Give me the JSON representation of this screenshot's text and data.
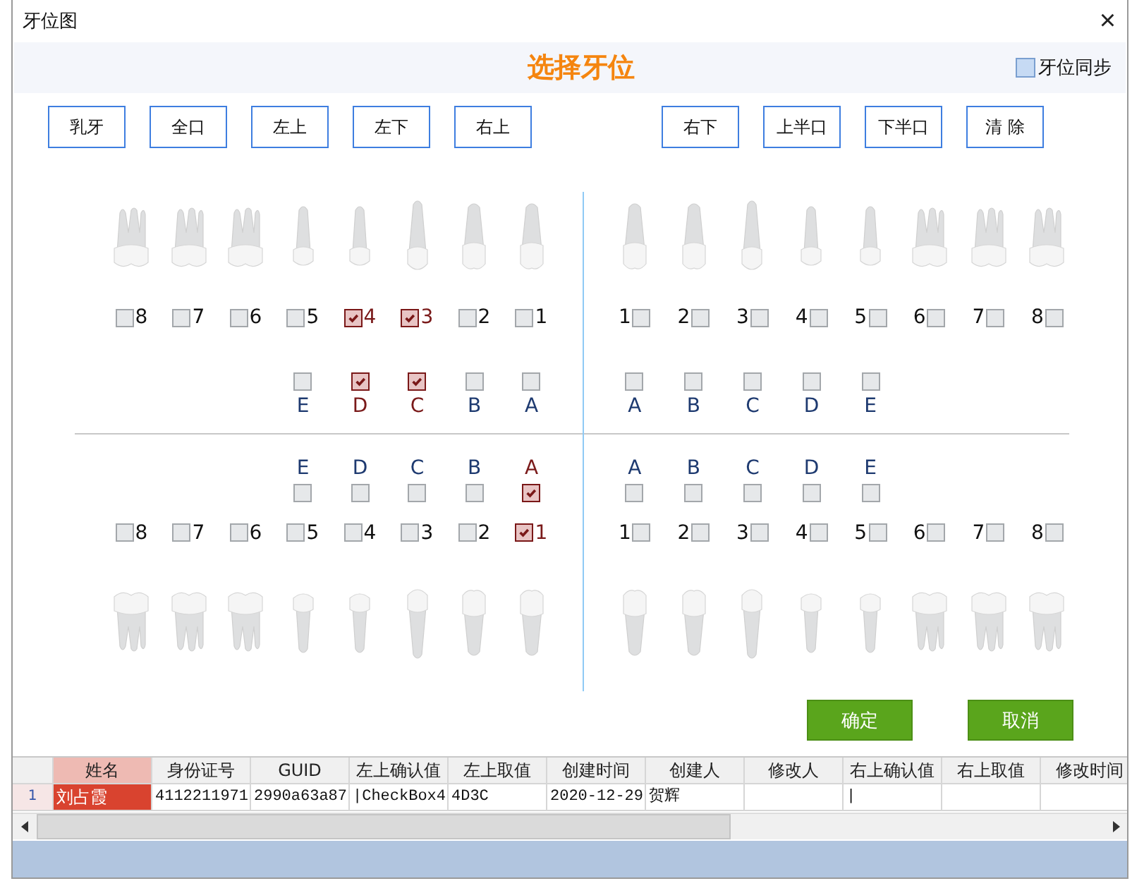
{
  "window": {
    "title": "牙位图",
    "close": "×"
  },
  "header": {
    "title": "选择牙位",
    "sync": {
      "label": "牙位同步",
      "checked": false
    }
  },
  "buttons_left": [
    "乳牙",
    "全口",
    "左上",
    "左下",
    "右上"
  ],
  "buttons_right": [
    "右下",
    "上半口",
    "下半口",
    "清 除"
  ],
  "quadrants": {
    "upper_left": {
      "teeth": [
        {
          "label": "8",
          "kind": "molar",
          "checked": false
        },
        {
          "label": "7",
          "kind": "molar",
          "checked": false
        },
        {
          "label": "6",
          "kind": "molar",
          "checked": false
        },
        {
          "label": "5",
          "kind": "premolar",
          "checked": false
        },
        {
          "label": "4",
          "kind": "premolar",
          "checked": true
        },
        {
          "label": "3",
          "kind": "canine",
          "checked": true
        },
        {
          "label": "2",
          "kind": "incisor",
          "checked": false
        },
        {
          "label": "1",
          "kind": "incisor",
          "checked": false
        }
      ],
      "primary": [
        {
          "label": "E",
          "checked": false
        },
        {
          "label": "D",
          "checked": true
        },
        {
          "label": "C",
          "checked": true
        },
        {
          "label": "B",
          "checked": false
        },
        {
          "label": "A",
          "checked": false
        }
      ]
    },
    "upper_right": {
      "teeth": [
        {
          "label": "1",
          "kind": "incisor",
          "checked": false
        },
        {
          "label": "2",
          "kind": "incisor",
          "checked": false
        },
        {
          "label": "3",
          "kind": "canine",
          "checked": false
        },
        {
          "label": "4",
          "kind": "premolar",
          "checked": false
        },
        {
          "label": "5",
          "kind": "premolar",
          "checked": false
        },
        {
          "label": "6",
          "kind": "molar",
          "checked": false
        },
        {
          "label": "7",
          "kind": "molar",
          "checked": false
        },
        {
          "label": "8",
          "kind": "molar",
          "checked": false
        }
      ],
      "primary": [
        {
          "label": "A",
          "checked": false
        },
        {
          "label": "B",
          "checked": false
        },
        {
          "label": "C",
          "checked": false
        },
        {
          "label": "D",
          "checked": false
        },
        {
          "label": "E",
          "checked": false
        }
      ]
    },
    "lower_left": {
      "teeth": [
        {
          "label": "8",
          "kind": "molar",
          "checked": false
        },
        {
          "label": "7",
          "kind": "molar",
          "checked": false
        },
        {
          "label": "6",
          "kind": "molar",
          "checked": false
        },
        {
          "label": "5",
          "kind": "premolar",
          "checked": false
        },
        {
          "label": "4",
          "kind": "premolar",
          "checked": false
        },
        {
          "label": "3",
          "kind": "canine",
          "checked": false
        },
        {
          "label": "2",
          "kind": "incisor",
          "checked": false
        },
        {
          "label": "1",
          "kind": "incisor",
          "checked": true
        }
      ],
      "primary": [
        {
          "label": "E",
          "checked": false
        },
        {
          "label": "D",
          "checked": false
        },
        {
          "label": "C",
          "checked": false
        },
        {
          "label": "B",
          "checked": false
        },
        {
          "label": "A",
          "checked": true
        }
      ]
    },
    "lower_right": {
      "teeth": [
        {
          "label": "1",
          "kind": "incisor",
          "checked": false
        },
        {
          "label": "2",
          "kind": "incisor",
          "checked": false
        },
        {
          "label": "3",
          "kind": "canine",
          "checked": false
        },
        {
          "label": "4",
          "kind": "premolar",
          "checked": false
        },
        {
          "label": "5",
          "kind": "premolar",
          "checked": false
        },
        {
          "label": "6",
          "kind": "molar",
          "checked": false
        },
        {
          "label": "7",
          "kind": "molar",
          "checked": false
        },
        {
          "label": "8",
          "kind": "molar",
          "checked": false
        }
      ],
      "primary": [
        {
          "label": "A",
          "checked": false
        },
        {
          "label": "B",
          "checked": false
        },
        {
          "label": "C",
          "checked": false
        },
        {
          "label": "D",
          "checked": false
        },
        {
          "label": "E",
          "checked": false
        }
      ]
    }
  },
  "actions": [
    "确定",
    "取消"
  ],
  "table": {
    "columns": [
      {
        "label": "姓名",
        "selected": true
      },
      {
        "label": "身份证号",
        "selected": false
      },
      {
        "label": "GUID",
        "selected": false
      },
      {
        "label": "左上确认值",
        "selected": false
      },
      {
        "label": "左上取值",
        "selected": false
      },
      {
        "label": "创建时间",
        "selected": false
      },
      {
        "label": "创建人",
        "selected": false
      },
      {
        "label": "修改人",
        "selected": false
      },
      {
        "label": "右上确认值",
        "selected": false
      },
      {
        "label": "右上取值",
        "selected": false
      },
      {
        "label": "修改时间",
        "selected": false
      }
    ],
    "rows": [
      {
        "number": "1",
        "cells": [
          {
            "text": "刘占霞",
            "selected": true
          },
          {
            "text": "4112211971",
            "selected": false
          },
          {
            "text": "2990a63a87",
            "selected": false
          },
          {
            "text": "|CheckBox4",
            "selected": false
          },
          {
            "text": "4D3C",
            "selected": false
          },
          {
            "text": "2020-12-29",
            "selected": false
          },
          {
            "text": "贺辉",
            "selected": false
          },
          {
            "selected": false
          },
          {
            "text": "|",
            "selected": false
          },
          {
            "selected": false
          },
          {
            "selected": false
          }
        ]
      }
    ]
  }
}
